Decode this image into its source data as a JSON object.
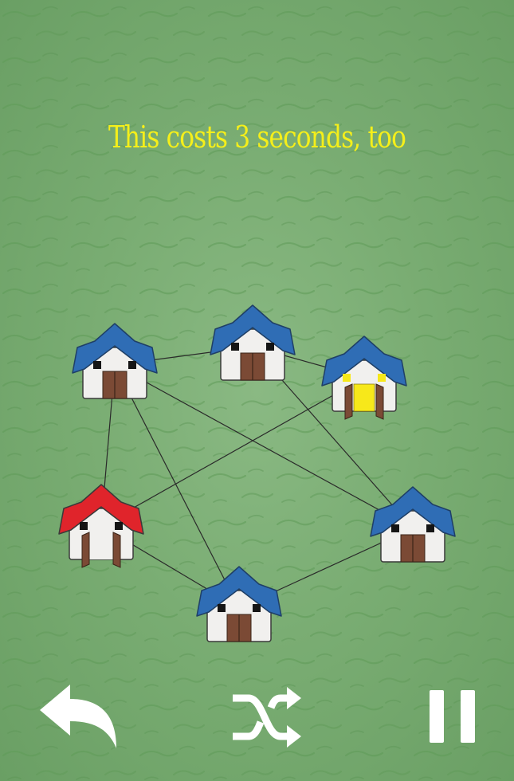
{
  "hint": {
    "text": "This costs 3 seconds, too",
    "color": "#f5ef1a"
  },
  "colors": {
    "grass": "#7aad73",
    "roof_blue": "#2f6db5",
    "roof_red": "#e0242b",
    "wall": "#f1f0ee",
    "door": "#7b4a35",
    "window": "#151515",
    "highlight": "#f7e81a",
    "line": "#2a2a2a",
    "icon": "#ffffff"
  },
  "houses": [
    {
      "id": "top-left",
      "roof": "blue",
      "door": "closed"
    },
    {
      "id": "top-middle",
      "roof": "blue",
      "door": "closed"
    },
    {
      "id": "top-right",
      "roof": "blue",
      "door": "open-lit"
    },
    {
      "id": "middle-left",
      "roof": "red",
      "door": "open"
    },
    {
      "id": "middle-right",
      "roof": "blue",
      "door": "closed"
    },
    {
      "id": "bottom",
      "roof": "blue",
      "door": "closed"
    }
  ],
  "roads": [
    [
      "top-left",
      "top-middle"
    ],
    [
      "top-left",
      "middle-left"
    ],
    [
      "top-left",
      "bottom"
    ],
    [
      "top-left",
      "middle-right"
    ],
    [
      "top-middle",
      "top-right"
    ],
    [
      "top-middle",
      "middle-right"
    ],
    [
      "top-right",
      "middle-left"
    ],
    [
      "middle-left",
      "bottom"
    ],
    [
      "bottom",
      "middle-right"
    ]
  ],
  "controls": {
    "undo": "undo-arrow-icon",
    "shuffle": "shuffle-icon",
    "pause": "pause-icon"
  }
}
